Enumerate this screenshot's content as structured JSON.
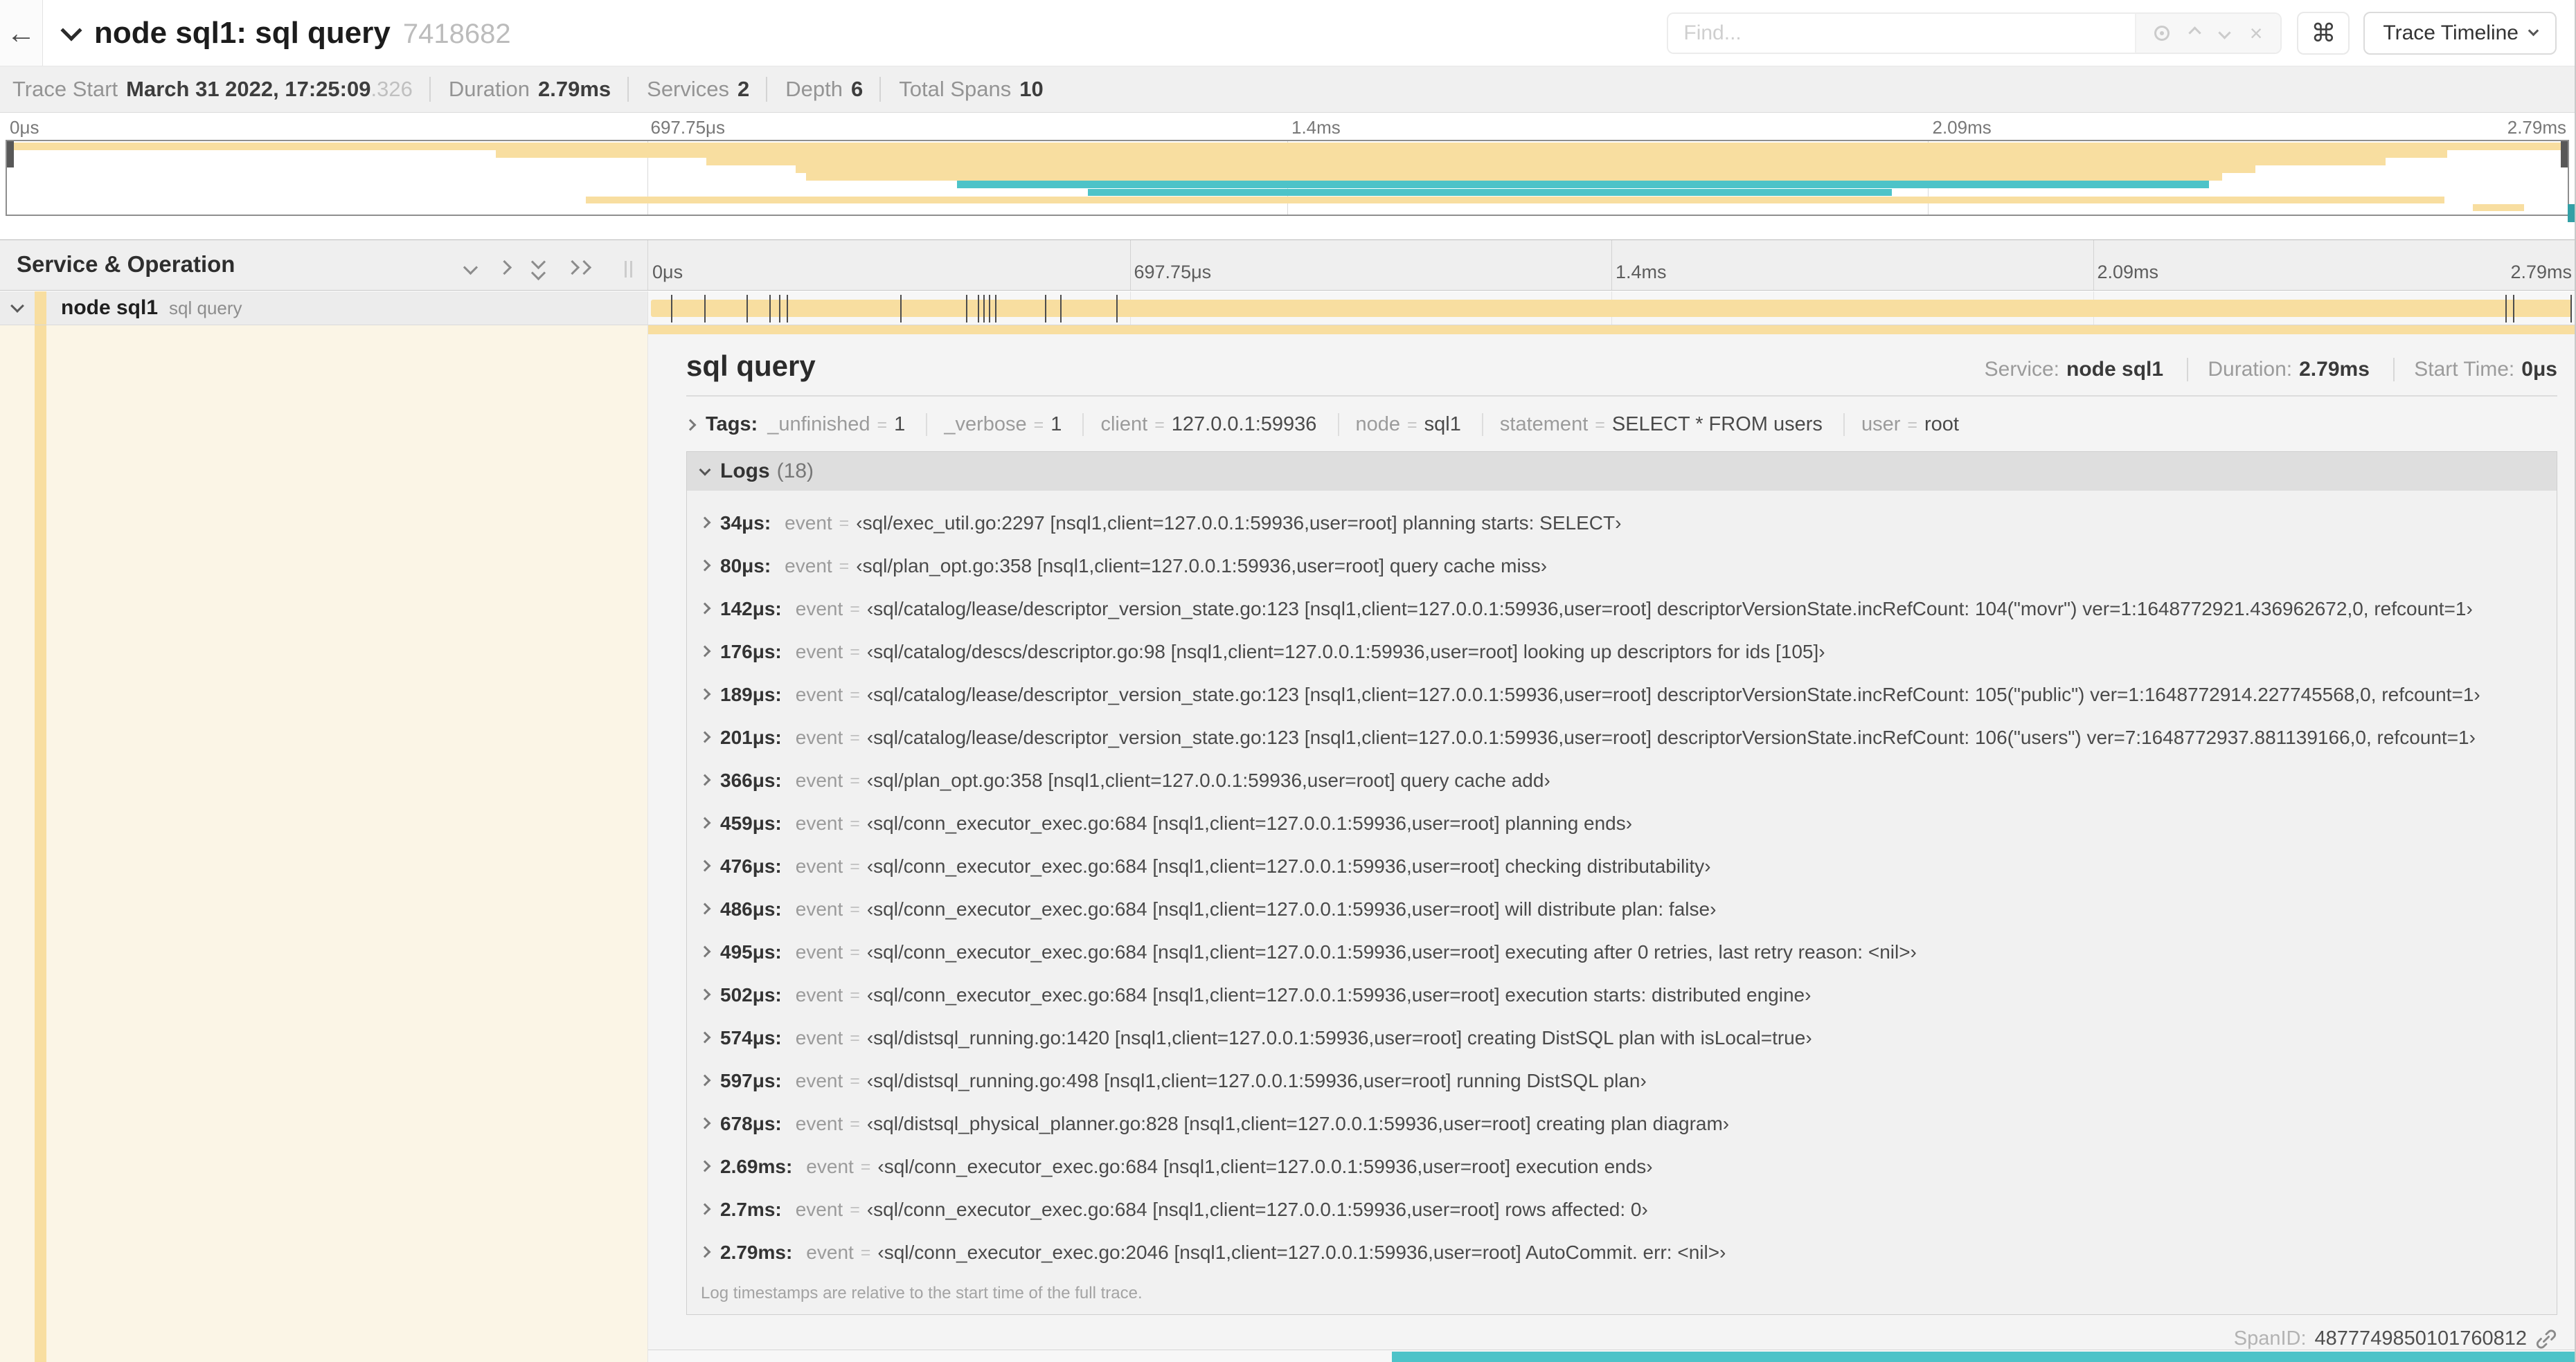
{
  "colors": {
    "span_tan": "#F8DEA0",
    "span_teal": "#4DC3C8"
  },
  "header": {
    "title": "node sql1: sql query",
    "trace_id": "7418682",
    "find_placeholder": "Find...",
    "view_button": "Trace Timeline"
  },
  "summary": {
    "items": [
      {
        "label": "Trace Start",
        "value": "March 31 2022, 17:25:09",
        "suffix": ".326"
      },
      {
        "label": "Duration",
        "value": "2.79ms"
      },
      {
        "label": "Services",
        "value": "2"
      },
      {
        "label": "Depth",
        "value": "6"
      },
      {
        "label": "Total Spans",
        "value": "10"
      }
    ]
  },
  "minimap": {
    "spans": [
      {
        "l": 0,
        "w": 100,
        "c": "#F8DEA0"
      },
      {
        "l": 19.1,
        "w": 76.2,
        "c": "#F8DEA0"
      },
      {
        "l": 27.3,
        "w": 65.6,
        "c": "#F8DEA0"
      },
      {
        "l": 30.8,
        "w": 57.0,
        "c": "#F8DEA0"
      },
      {
        "l": 31.2,
        "w": 55.3,
        "c": "#F8DEA0"
      },
      {
        "l": 37.1,
        "w": 48.9,
        "c": "#4DC3C8"
      },
      {
        "l": 42.2,
        "w": 31.4,
        "c": "#4DC3C8"
      },
      {
        "l": 22.6,
        "w": 72.6,
        "c": "#F8DEA0"
      },
      {
        "l": 96.3,
        "w": 2.0,
        "c": "#F8DEA0"
      }
    ]
  },
  "timeline": {
    "left_header": "Service & Operation",
    "ticks": [
      {
        "label": "0μs",
        "pct": 0
      },
      {
        "label": "697.75μs",
        "pct": 25
      },
      {
        "label": "1.4ms",
        "pct": 50
      },
      {
        "label": "2.09ms",
        "pct": 75
      },
      {
        "label": "2.79ms",
        "pct": 100
      }
    ],
    "row": {
      "service": "node sql1",
      "operation": "sql query",
      "color": "#F8DEA0"
    },
    "log_marks_pct": [
      1.2,
      2.9,
      5.1,
      6.3,
      6.8,
      7.2,
      13.1,
      16.5,
      17.1,
      17.4,
      17.7,
      18.0,
      20.6,
      21.4,
      24.3,
      96.4,
      96.8,
      99.8
    ]
  },
  "detail": {
    "title": "sql query",
    "color": "#F8DEA0",
    "meta": [
      {
        "label": "Service:",
        "value": "node sql1"
      },
      {
        "label": "Duration:",
        "value": "2.79ms"
      },
      {
        "label": "Start Time:",
        "value": "0μs"
      }
    ],
    "tags_label": "Tags:",
    "tags": [
      {
        "key": "_unfinished",
        "value": "1"
      },
      {
        "key": "_verbose",
        "value": "1"
      },
      {
        "key": "client",
        "value": "127.0.0.1:59936"
      },
      {
        "key": "node",
        "value": "sql1"
      },
      {
        "key": "statement",
        "value": "SELECT * FROM users"
      },
      {
        "key": "user",
        "value": "root"
      }
    ],
    "logs_label": "Logs",
    "logs_count": "(18)",
    "logs": [
      {
        "t": "34μs:",
        "k": "event",
        "v": "‹sql/exec_util.go:2297 [nsql1,client=127.0.0.1:59936,user=root] planning starts: SELECT›"
      },
      {
        "t": "80μs:",
        "k": "event",
        "v": "‹sql/plan_opt.go:358 [nsql1,client=127.0.0.1:59936,user=root] query cache miss›"
      },
      {
        "t": "142μs:",
        "k": "event",
        "v": "‹sql/catalog/lease/descriptor_version_state.go:123 [nsql1,client=127.0.0.1:59936,user=root] descriptorVersionState.incRefCount: 104(\"movr\") ver=1:1648772921.436962672,0, refcount=1›"
      },
      {
        "t": "176μs:",
        "k": "event",
        "v": "‹sql/catalog/descs/descriptor.go:98 [nsql1,client=127.0.0.1:59936,user=root] looking up descriptors for ids [105]›"
      },
      {
        "t": "189μs:",
        "k": "event",
        "v": "‹sql/catalog/lease/descriptor_version_state.go:123 [nsql1,client=127.0.0.1:59936,user=root] descriptorVersionState.incRefCount: 105(\"public\") ver=1:1648772914.227745568,0, refcount=1›"
      },
      {
        "t": "201μs:",
        "k": "event",
        "v": "‹sql/catalog/lease/descriptor_version_state.go:123 [nsql1,client=127.0.0.1:59936,user=root] descriptorVersionState.incRefCount: 106(\"users\") ver=7:1648772937.881139166,0, refcount=1›"
      },
      {
        "t": "366μs:",
        "k": "event",
        "v": "‹sql/plan_opt.go:358 [nsql1,client=127.0.0.1:59936,user=root] query cache add›"
      },
      {
        "t": "459μs:",
        "k": "event",
        "v": "‹sql/conn_executor_exec.go:684 [nsql1,client=127.0.0.1:59936,user=root] planning ends›"
      },
      {
        "t": "476μs:",
        "k": "event",
        "v": "‹sql/conn_executor_exec.go:684 [nsql1,client=127.0.0.1:59936,user=root] checking distributability›"
      },
      {
        "t": "486μs:",
        "k": "event",
        "v": "‹sql/conn_executor_exec.go:684 [nsql1,client=127.0.0.1:59936,user=root] will distribute plan: false›"
      },
      {
        "t": "495μs:",
        "k": "event",
        "v": "‹sql/conn_executor_exec.go:684 [nsql1,client=127.0.0.1:59936,user=root] executing after 0 retries, last retry reason: <nil>›"
      },
      {
        "t": "502μs:",
        "k": "event",
        "v": "‹sql/conn_executor_exec.go:684 [nsql1,client=127.0.0.1:59936,user=root] execution starts: distributed engine›"
      },
      {
        "t": "574μs:",
        "k": "event",
        "v": "‹sql/distsql_running.go:1420 [nsql1,client=127.0.0.1:59936,user=root] creating DistSQL plan with isLocal=true›"
      },
      {
        "t": "597μs:",
        "k": "event",
        "v": "‹sql/distsql_running.go:498 [nsql1,client=127.0.0.1:59936,user=root] running DistSQL plan›"
      },
      {
        "t": "678μs:",
        "k": "event",
        "v": "‹sql/distsql_physical_planner.go:828 [nsql1,client=127.0.0.1:59936,user=root] creating plan diagram›"
      },
      {
        "t": "2.69ms:",
        "k": "event",
        "v": "‹sql/conn_executor_exec.go:684 [nsql1,client=127.0.0.1:59936,user=root] execution ends›"
      },
      {
        "t": "2.7ms:",
        "k": "event",
        "v": "‹sql/conn_executor_exec.go:684 [nsql1,client=127.0.0.1:59936,user=root] rows affected: 0›"
      },
      {
        "t": "2.79ms:",
        "k": "event",
        "v": "‹sql/conn_executor_exec.go:2046 [nsql1,client=127.0.0.1:59936,user=root] AutoCommit. err: <nil>›"
      }
    ],
    "footer": "Log timestamps are relative to the start time of the full trace.",
    "span_id_label": "SpanID:",
    "span_id": "4877749850101760812",
    "next_span": {
      "start_pct": 38.6,
      "color": "#4DC3C8"
    }
  }
}
